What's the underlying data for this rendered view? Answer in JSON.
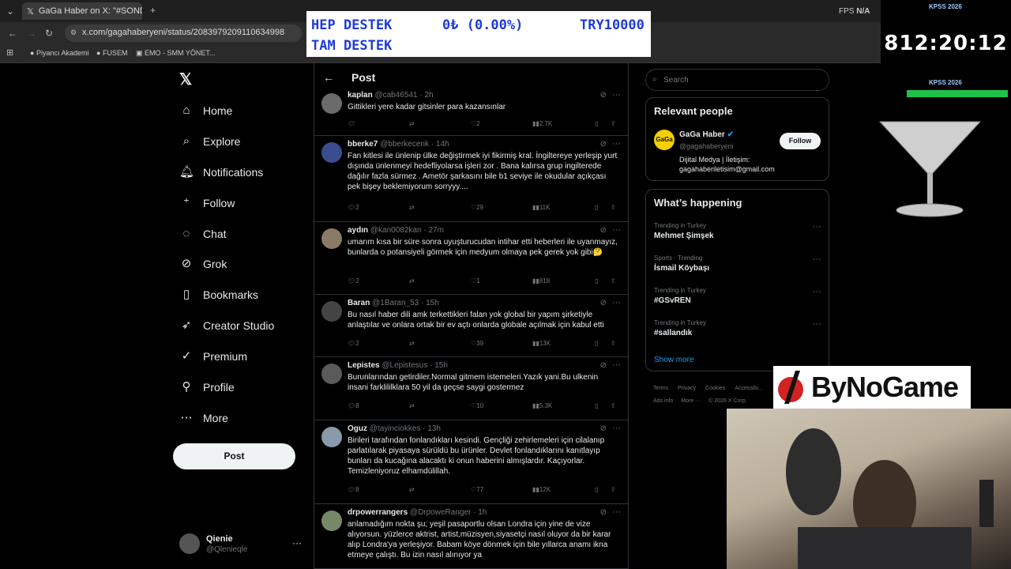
{
  "browser": {
    "tab_title": "GaGa Haber on X: \"#SONDAKİ...",
    "url": "x.com/gagahaberyeni/status/2083979209110634998",
    "bookmarks": [
      "Piyancı Akademi",
      "FUSEM",
      "EMO - SMM YÖNET..."
    ],
    "fps_label": "FPS",
    "fps_value": "N/A"
  },
  "overlay": {
    "line1_left": "HEP DESTEK",
    "line1_mid": "0₺ (0.00%)",
    "line1_right": "TRY10000",
    "line2": "TAM DESTEK",
    "timer": "812:20:12",
    "timer_label_top": "KPSS 2026",
    "timer_label_bottom": "KPSS 2026",
    "progress": 1.0,
    "sponsor": "ByNoGame"
  },
  "nav": {
    "items": [
      {
        "label": "Home",
        "icon": "home-icon"
      },
      {
        "label": "Explore",
        "icon": "search-icon"
      },
      {
        "label": "Notifications",
        "icon": "bell-icon"
      },
      {
        "label": "Follow",
        "icon": "add-person-icon"
      },
      {
        "label": "Chat",
        "icon": "chat-icon"
      },
      {
        "label": "Grok",
        "icon": "grok-icon"
      },
      {
        "label": "Bookmarks",
        "icon": "bookmark-icon"
      },
      {
        "label": "Creator Studio",
        "icon": "rocket-icon"
      },
      {
        "label": "Premium",
        "icon": "check-badge-icon"
      },
      {
        "label": "Profile",
        "icon": "person-icon"
      },
      {
        "label": "More",
        "icon": "more-circle-icon"
      }
    ],
    "post_label": "Post",
    "user_name": "Qienie",
    "user_handle": "@Qlenieqle"
  },
  "header": {
    "title": "Post"
  },
  "posts": [
    {
      "name": "kaplan",
      "handle": "@cab46541",
      "time": "2h",
      "text": "Gittikleri yere kadar gitsinler para kazansınlar",
      "replies": "",
      "reposts": "",
      "likes": "2",
      "views": "2.7K"
    },
    {
      "name": "bberke7",
      "handle": "@bberkecenk",
      "time": "14h",
      "text": "Fan kitlesi ile ünlenip ülke değiştirmek iyi fikirmiş kral. İngiltereye yerleşip yurt dışında ünlenmeyi hedefliyolarsa işleri zor . Bana kalırsa grup ingilterede dağılır fazla sürmez . Ametör şarkasını bile b1 seviye ile okudular açıkçası pek bişey beklemiyorum sorryyy....",
      "replies": "2",
      "reposts": "",
      "likes": "29",
      "views": "11K"
    },
    {
      "name": "aydın",
      "handle": "@kan0082kan",
      "time": "27m",
      "text": "umarım kısa bir süre sonra uyuşturucudan intihar etti heberleri ile uyanmayız, bunlarda o potansiyeli görmek için medyum olmaya pek gerek yok gibi🤔",
      "replies": "2",
      "reposts": "",
      "likes": "1",
      "views": "818"
    },
    {
      "name": "Baran",
      "handle": "@1Baran_53",
      "time": "15h",
      "text": "Bu nasıl haber dili amk terkettikleri falan yok global bir yapım şirketiyle anlaştılar ve onlara ortak bir ev açtı onlarda globale açılmak için kabul etti",
      "replies": "2",
      "reposts": "",
      "likes": "39",
      "views": "13K"
    },
    {
      "name": "Lepistes",
      "handle": "@Lepistesus",
      "time": "15h",
      "text": "Burunlarından getirdiler.Normal gitmem istemeleri.Yazık yani.Bu ulkenin insani farklililklara 50 yil da geçse saygi gostermez",
      "replies": "8",
      "reposts": "",
      "likes": "10",
      "views": "5.3K"
    },
    {
      "name": "Oguz",
      "handle": "@tayinciokkes",
      "time": "13h",
      "text": "Birileri tarafından fonlandıkları kesindi. Gençliği zehirlemeleri için cilalanıp parlatılarak piyasaya sürüldü bu ürünler. Devlet fonlandıklarını kanıtlayıp bunları da kucağına alacaktı ki onun haberini almışlardır. Kaçıyorlar. Temizleniyoruz elhamdülillah.",
      "replies": "8",
      "reposts": "",
      "likes": "77",
      "views": "12K"
    },
    {
      "name": "drpowerrangers",
      "handle": "@DrpoweRanger",
      "time": "1h",
      "text": "anlamadığım nokta şu; yeşil pasaportlu olsan Londra için yine de vize alıyorsun. yüzlerce aktrist, artist,müzisyen,siyasetçi nasıl oluyor da bir karar alıp Londra'ya yerleşiyor. Babam köye dönmek için bile yıllarca anamı ikna etmeye çalıştı. Bu izin nasıl alınıyor ya",
      "replies": "",
      "reposts": "",
      "likes": "",
      "views": ""
    }
  ],
  "sidebar": {
    "search_placeholder": "Search",
    "relevant_title": "Relevant people",
    "person_name": "GaGa Haber",
    "person_handle": "@gagahaberyeni",
    "person_bio": "Dijital Medya | İletişim: gagahaberiletisim@gmail.com",
    "follow_label": "Follow",
    "happening_title": "What’s happening",
    "trends": [
      {
        "sub": "Trending in Turkey",
        "name": "Mehmet Şimşek"
      },
      {
        "sub": "Sports · Trending",
        "name": "İsmail Köybaşı"
      },
      {
        "sub": "Trending in Turkey",
        "name": "#GSvREN"
      },
      {
        "sub": "Trending in Turkey",
        "name": "#sallandık"
      }
    ],
    "show_more": "Show more",
    "footer": [
      "Terms",
      "Privacy",
      "Cookies",
      "Accessibi..."
    ],
    "footer2": [
      "Ads info",
      "More ···",
      "© 2026 X Corp."
    ]
  },
  "colors": {
    "accent": "#1d9bf0",
    "bg": "#000000",
    "border": "#2f3336",
    "muted": "#71767b"
  }
}
